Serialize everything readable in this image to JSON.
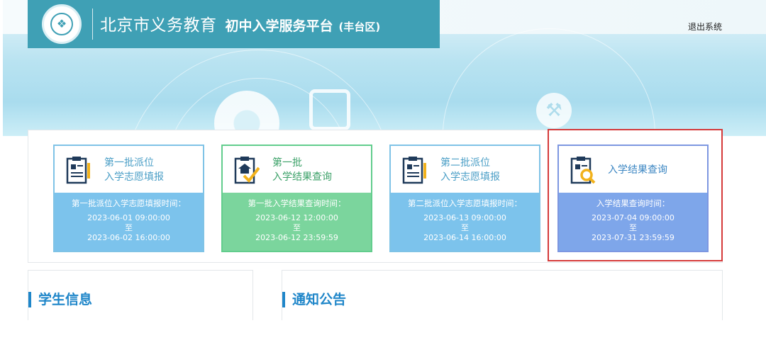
{
  "header": {
    "title_main": "北京市义务教育",
    "title_sub": "初中入学服务平台",
    "district": "(丰台区)"
  },
  "topbar": {
    "logout_label": "退出系统"
  },
  "colors": {
    "header_bg": "#3fa0b5",
    "card_blue": "#7cc3ec",
    "card_green": "#7bd59d",
    "card_purple": "#7ea6ea",
    "highlight_border": "#d53a3a",
    "section_title": "#1f86c9"
  },
  "cards": [
    {
      "icon": "clipboard-form-icon",
      "label_line1": "第一批派位",
      "label_line2": "入学志愿填报",
      "time_caption": "第一批派位入学志愿填报时间：",
      "time_start": "2023-06-01 09:00:00",
      "time_sep": "至",
      "time_end": "2023-06-02 16:00:00"
    },
    {
      "icon": "clipboard-check-icon",
      "label_line1": "第一批",
      "label_line2": "入学结果查询",
      "time_caption": "第一批入学结果查询时间：",
      "time_start": "2023-06-12 12:00:00",
      "time_sep": "至",
      "time_end": "2023-06-12 23:59:59"
    },
    {
      "icon": "clipboard-form-icon",
      "label_line1": "第二批派位",
      "label_line2": "入学志愿填报",
      "time_caption": "第二批派位入学志愿填报时间：",
      "time_start": "2023-06-13 09:00:00",
      "time_sep": "至",
      "time_end": "2023-06-14 16:00:00"
    },
    {
      "icon": "clipboard-search-icon",
      "label_line1": "入学结果查询",
      "time_caption": "入学结果查询时间：",
      "time_start": "2023-07-04 09:00:00",
      "time_sep": "至",
      "time_end": "2023-07-31 23:59:59"
    }
  ],
  "sections": {
    "student_info": "学生信息",
    "notices": "通知公告"
  }
}
